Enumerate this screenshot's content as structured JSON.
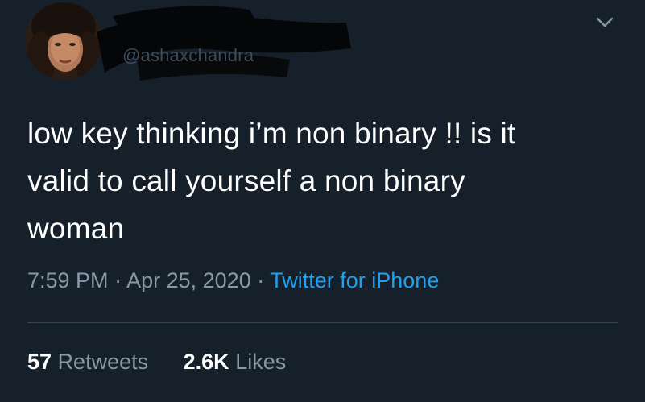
{
  "user": {
    "handle": "@ashaxchandra"
  },
  "tweet": {
    "line1": "low key thinking i’m non binary !! is it",
    "line2": "valid to call yourself a non binary",
    "line3": "woman",
    "time": "7:59 PM",
    "date": "Apr 25, 2020",
    "separator": "·",
    "source": "Twitter for iPhone"
  },
  "stats": {
    "retweets_count": "57",
    "retweets_label": "Retweets",
    "likes_count": "2.6K",
    "likes_label": "Likes"
  },
  "colors": {
    "background": "#15202b",
    "text": "#ffffff",
    "secondary": "#8899a6",
    "link": "#1da1f2"
  },
  "icons": {
    "menu": "chevron-down-icon"
  }
}
